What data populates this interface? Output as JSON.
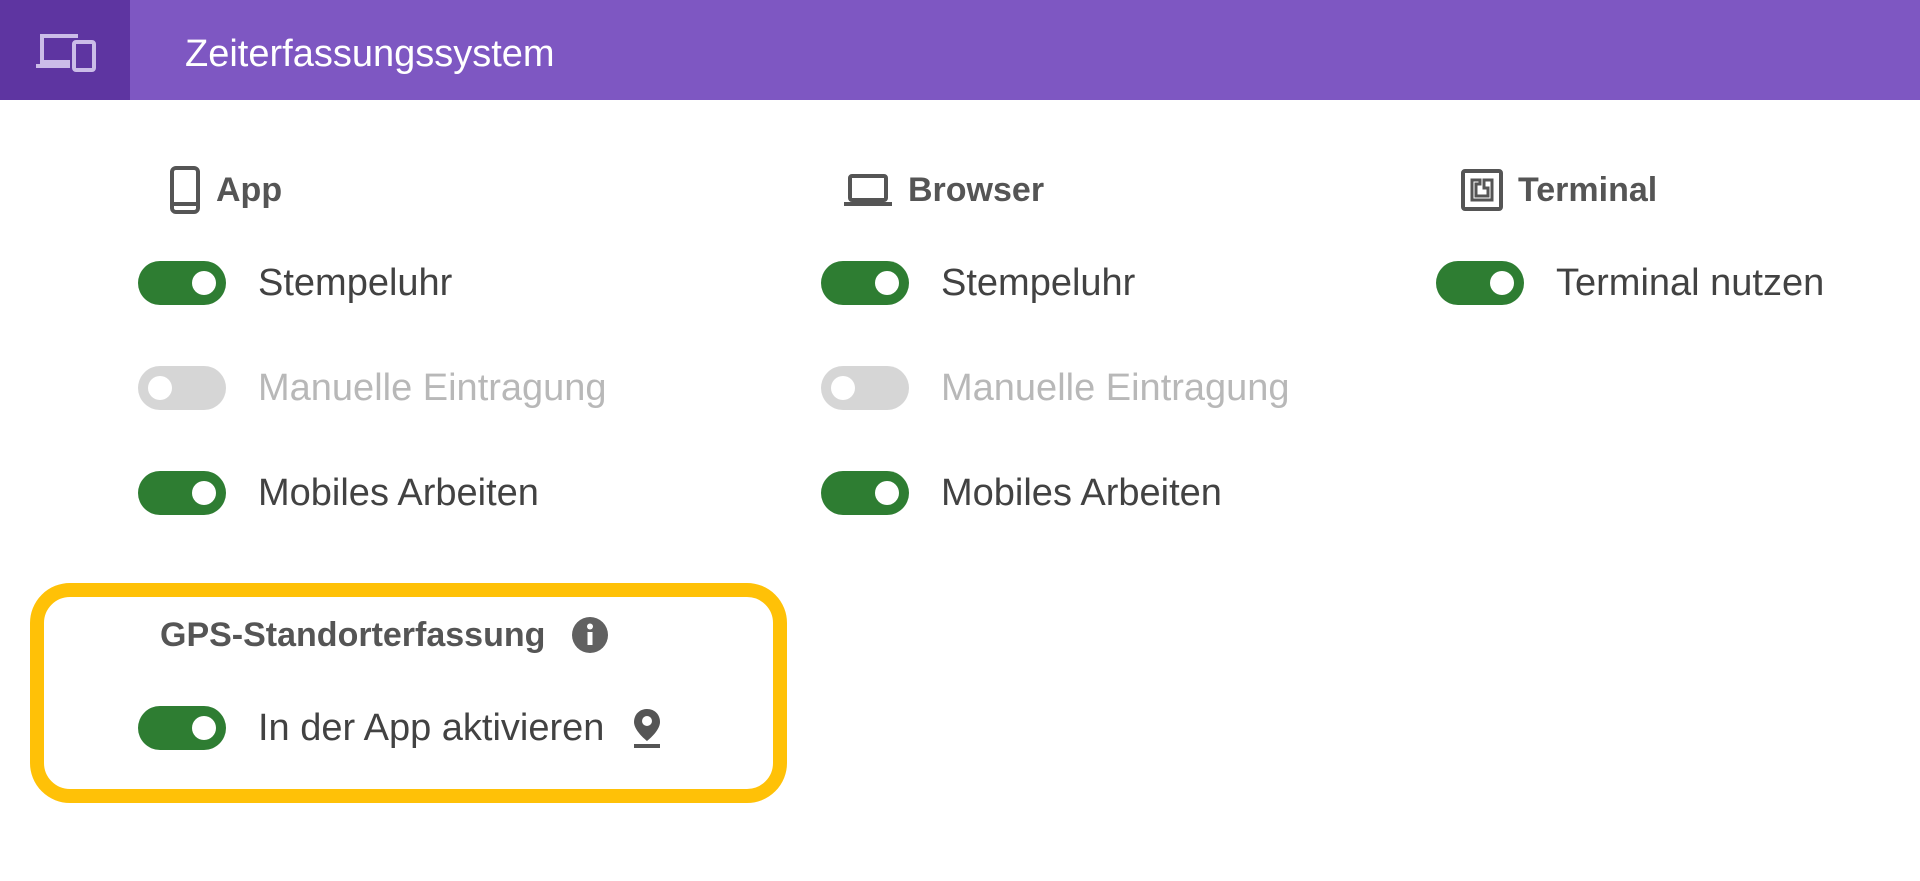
{
  "header": {
    "title": "Zeiterfassungssystem",
    "icon": "devices-icon",
    "background": "#7e57c2",
    "icon_background": "#5e35a1"
  },
  "colors": {
    "toggle_on": "#2e7d32",
    "toggle_off": "#d6d6d6",
    "highlight": "#ffc107"
  },
  "columns": [
    {
      "label": "App",
      "icon": "smartphone-icon",
      "options": [
        {
          "label": "Stempeluhr",
          "enabled": true,
          "disabled": false
        },
        {
          "label": "Manuelle Eintragung",
          "enabled": false,
          "disabled": true
        },
        {
          "label": "Mobiles Arbeiten",
          "enabled": true,
          "disabled": false
        }
      ]
    },
    {
      "label": "Browser",
      "icon": "laptop-icon",
      "options": [
        {
          "label": "Stempeluhr",
          "enabled": true,
          "disabled": false
        },
        {
          "label": "Manuelle Eintragung",
          "enabled": false,
          "disabled": true
        },
        {
          "label": "Mobiles Arbeiten",
          "enabled": true,
          "disabled": false
        }
      ]
    },
    {
      "label": "Terminal",
      "icon": "nfc-terminal-icon",
      "options": [
        {
          "label": "Terminal nutzen",
          "enabled": true,
          "disabled": false
        }
      ]
    }
  ],
  "gps": {
    "title": "GPS-Standorterfassung",
    "info_icon": "info-icon",
    "option": {
      "label": "In der App aktivieren",
      "enabled": true,
      "icon": "location-pin-icon"
    }
  }
}
